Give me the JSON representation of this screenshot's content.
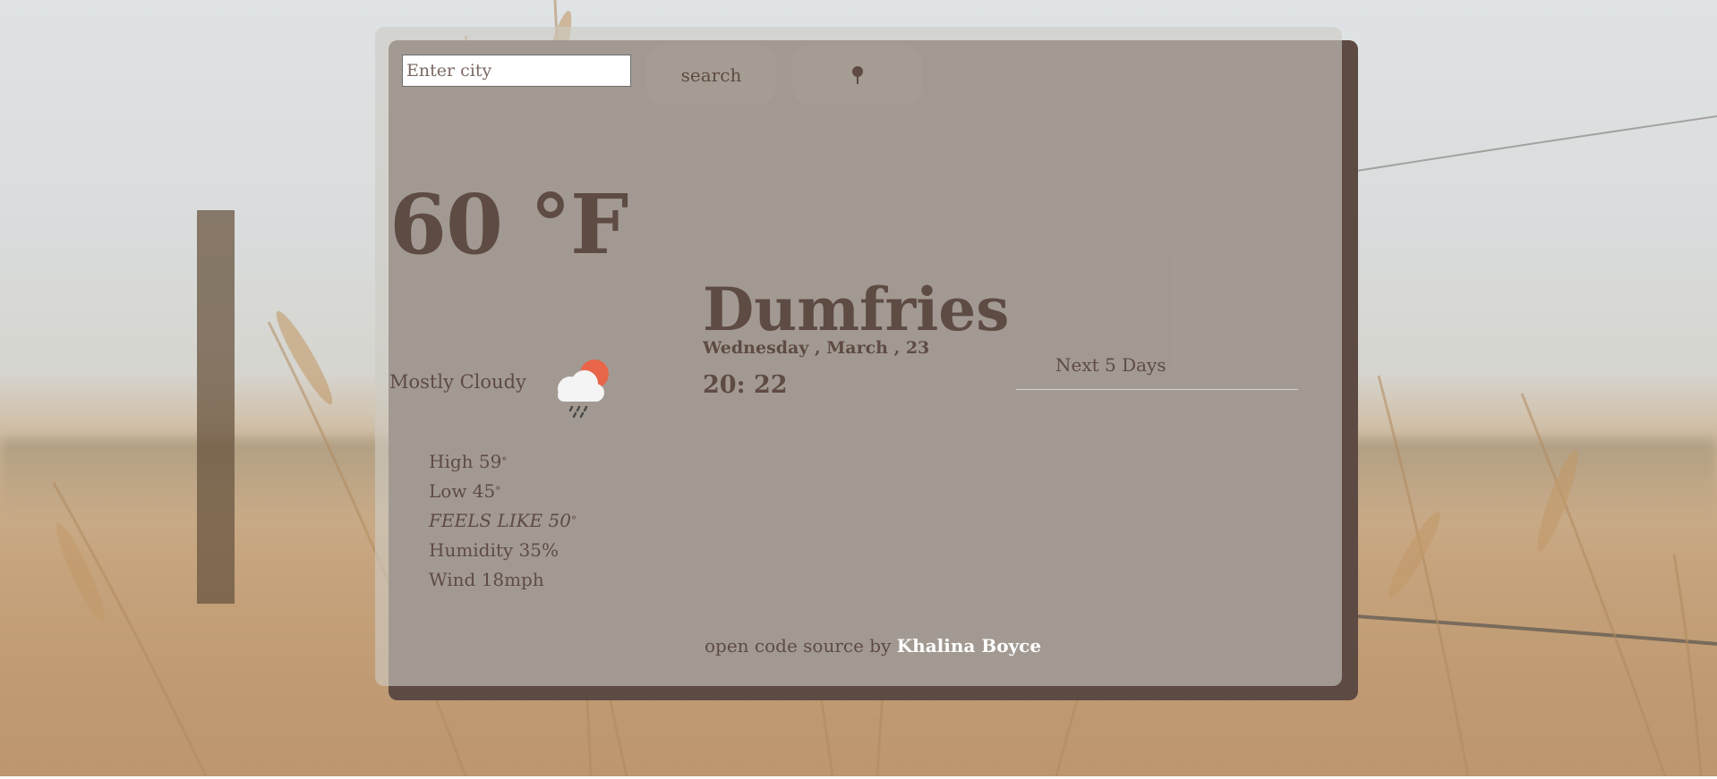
{
  "search": {
    "placeholder": "Enter city",
    "button_label": "search",
    "location_icon": "pin-icon"
  },
  "current": {
    "temperature": "60 °F",
    "condition": "Mostly Cloudy",
    "condition_icon": "cloud-rain-sun-icon",
    "high": "High 59",
    "low": "Low 45",
    "feels_like": "FEELS LIKE 50",
    "humidity": "Humidity 35%",
    "wind": "Wind 18mph",
    "degree_symbol": "°"
  },
  "location": {
    "city": "Dumfries",
    "date": "Wednesday , March , 23",
    "time": "20: 22"
  },
  "forecast": {
    "heading": "Next 5 Days"
  },
  "footer": {
    "prefix": "open code source by",
    "author": "Khalina Boyce"
  },
  "colors": {
    "text": "#5e4b43",
    "card_shadow": "#5c4a43",
    "sun": "#e8654a"
  }
}
